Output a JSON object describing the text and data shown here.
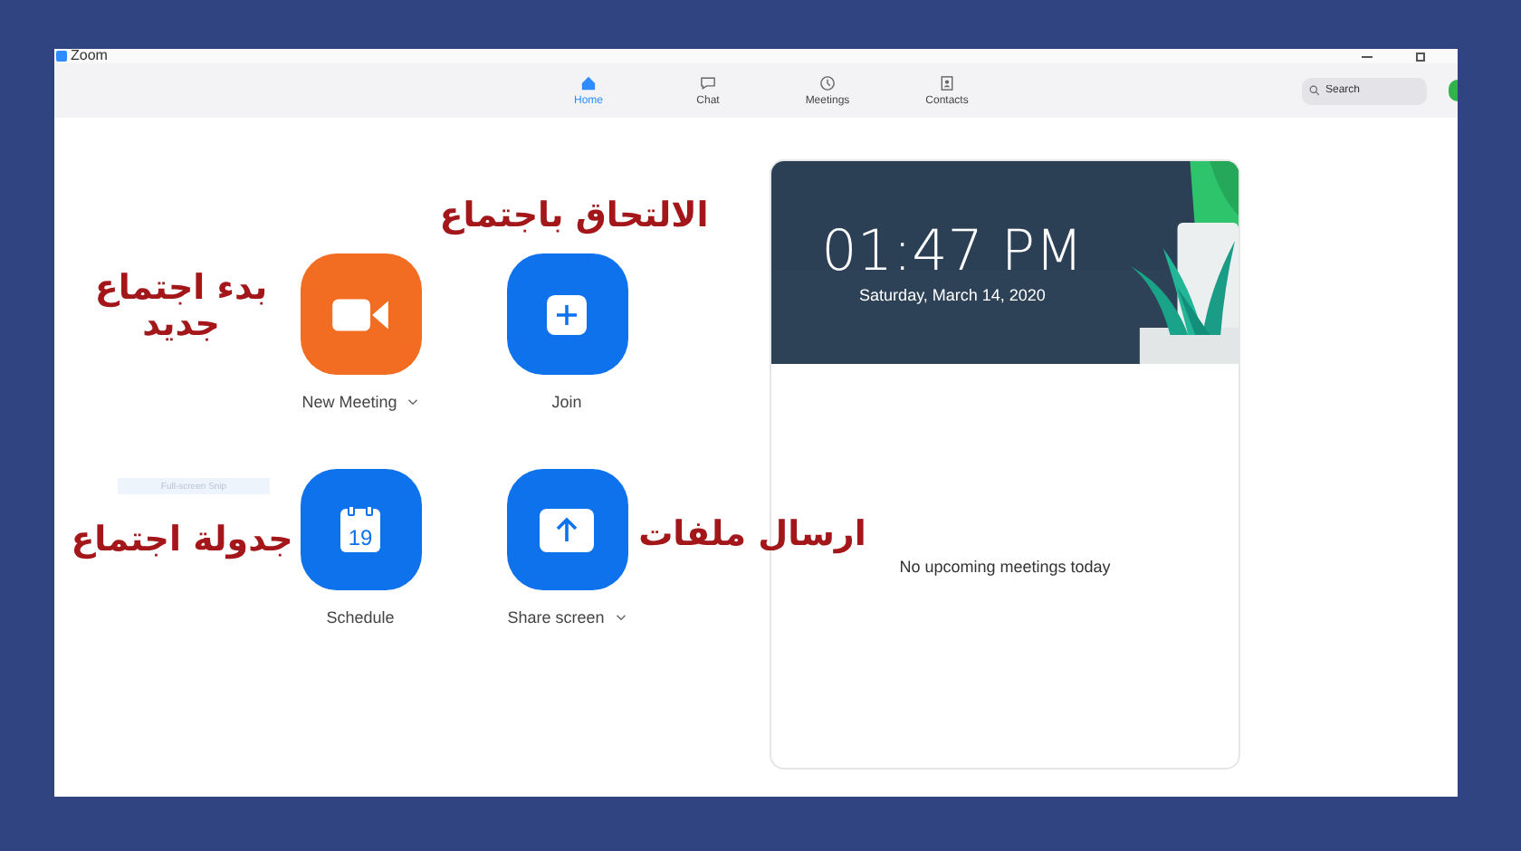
{
  "window": {
    "title": "Zoom"
  },
  "tabs": [
    {
      "label": "Home",
      "selected": true
    },
    {
      "label": "Chat",
      "selected": false
    },
    {
      "label": "Meetings",
      "selected": false
    },
    {
      "label": "Contacts",
      "selected": false
    }
  ],
  "search": {
    "placeholder": "Search"
  },
  "tooltip": "Full-screen Snip",
  "actions": [
    {
      "kind": "video",
      "label": "New Meeting",
      "dropdown": true,
      "color": "#f26d21"
    },
    {
      "kind": "join",
      "label": "Join",
      "dropdown": false,
      "color": "#0e72ed"
    },
    {
      "kind": "calendar",
      "label": "Schedule",
      "dropdown": false,
      "color": "#0e72ed",
      "icon_text": "19"
    },
    {
      "kind": "share",
      "label": "Share screen",
      "dropdown": true,
      "color": "#0e72ed"
    }
  ],
  "clock": {
    "time": "01:47 PM",
    "date": "Saturday, March 14, 2020"
  },
  "meetings": {
    "empty_text": "No upcoming meetings today"
  },
  "annotations": [
    {
      "text": "الالتحاق باجتماع"
    },
    {
      "text": "بدء اجتماع جديد"
    },
    {
      "text": "ارسال ملفات"
    },
    {
      "text": "جدولة اجتماع"
    }
  ]
}
